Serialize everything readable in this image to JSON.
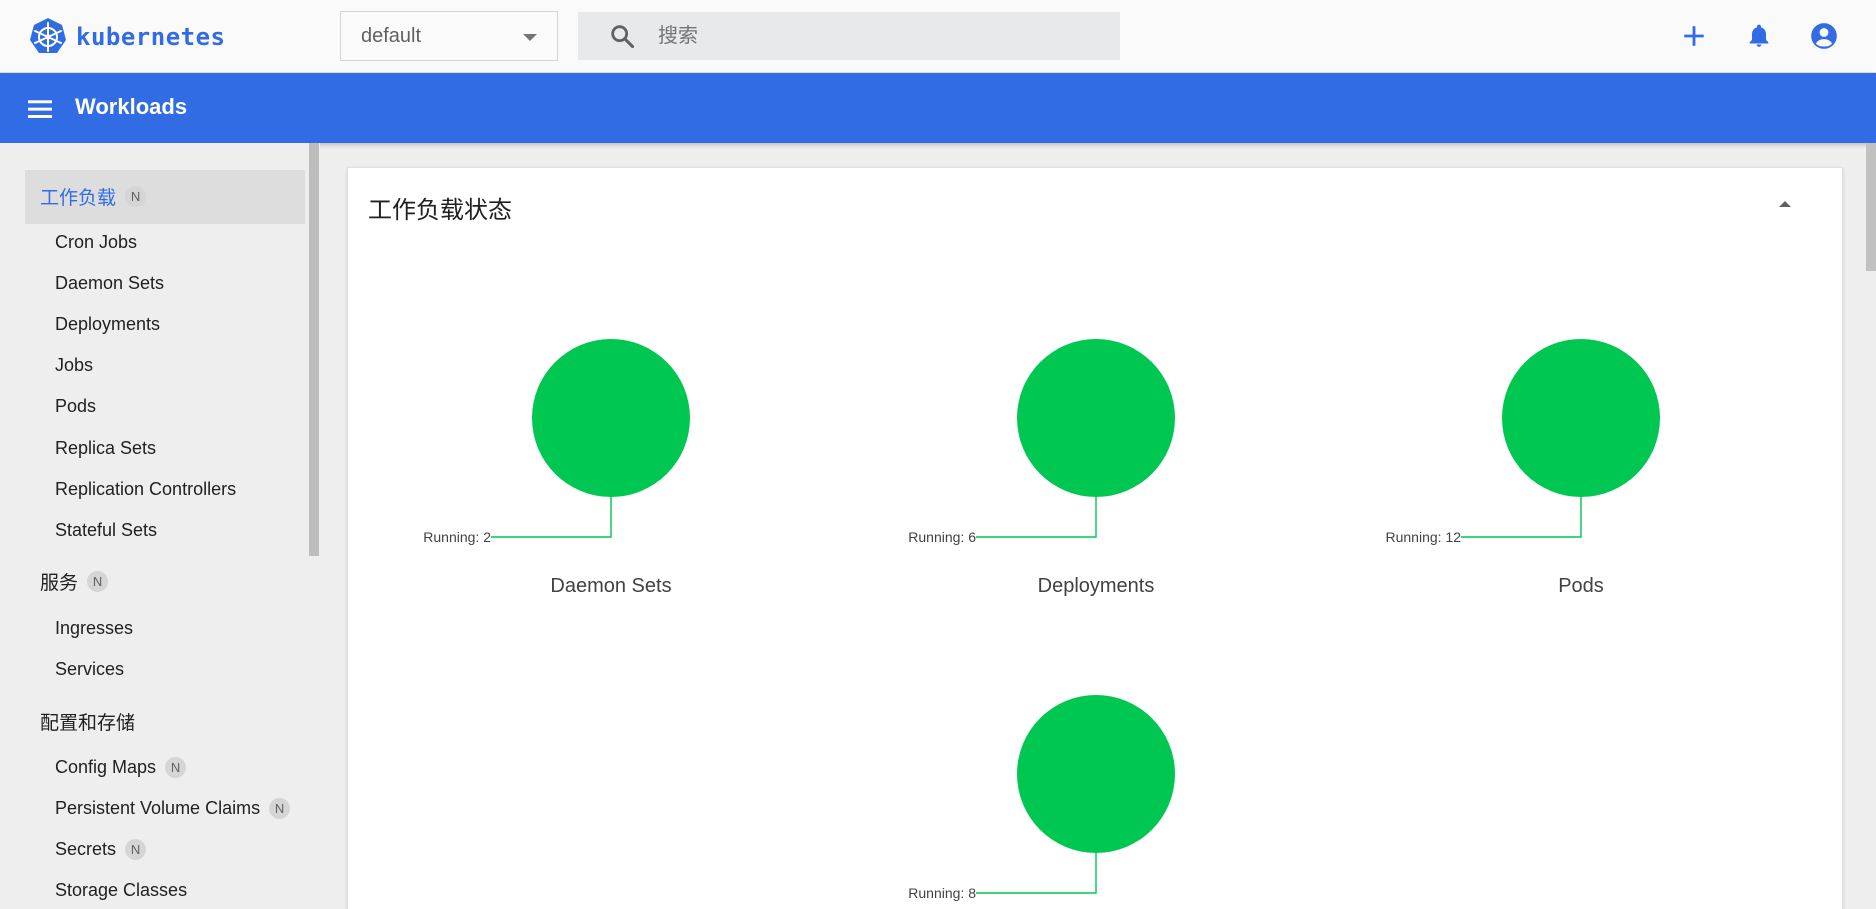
{
  "header": {
    "logo_text": "kubernetes",
    "namespace": "default",
    "search_placeholder": "搜索"
  },
  "titlebar": {
    "title": "Workloads"
  },
  "sidebar": {
    "sections": [
      {
        "label": "工作负载",
        "badge": "N",
        "active": true,
        "items": [
          {
            "label": "Cron Jobs"
          },
          {
            "label": "Daemon Sets"
          },
          {
            "label": "Deployments"
          },
          {
            "label": "Jobs"
          },
          {
            "label": "Pods"
          },
          {
            "label": "Replica Sets"
          },
          {
            "label": "Replication Controllers"
          },
          {
            "label": "Stateful Sets"
          }
        ]
      },
      {
        "label": "服务",
        "badge": "N",
        "items": [
          {
            "label": "Ingresses"
          },
          {
            "label": "Services"
          }
        ]
      },
      {
        "label": "配置和存储",
        "items": [
          {
            "label": "Config Maps",
            "badge": "N"
          },
          {
            "label": "Persistent Volume Claims",
            "badge": "N"
          },
          {
            "label": "Secrets",
            "badge": "N"
          },
          {
            "label": "Storage Classes"
          }
        ]
      }
    ]
  },
  "card": {
    "title": "工作负载状态"
  },
  "colors": {
    "brand": "#326ce5",
    "running": "#00c752"
  },
  "chart_data": [
    {
      "type": "pie",
      "title": "Daemon Sets",
      "slices": [
        {
          "label": "Running",
          "value": 2
        }
      ]
    },
    {
      "type": "pie",
      "title": "Deployments",
      "slices": [
        {
          "label": "Running",
          "value": 6
        }
      ]
    },
    {
      "type": "pie",
      "title": "Pods",
      "slices": [
        {
          "label": "Running",
          "value": 12
        }
      ]
    },
    {
      "type": "pie",
      "title": "",
      "slices": [
        {
          "label": "Running",
          "value": 8
        }
      ]
    }
  ]
}
